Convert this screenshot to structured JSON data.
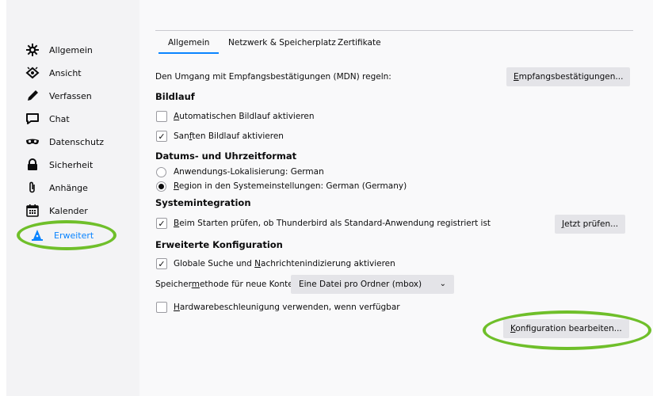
{
  "sidebar": {
    "items": [
      {
        "label": "Allgemein",
        "icon": "gear-icon"
      },
      {
        "label": "Ansicht",
        "icon": "view-icon"
      },
      {
        "label": "Verfassen",
        "icon": "pencil-icon"
      },
      {
        "label": "Chat",
        "icon": "chat-icon"
      },
      {
        "label": "Datenschutz",
        "icon": "mask-icon"
      },
      {
        "label": "Sicherheit",
        "icon": "lock-icon"
      },
      {
        "label": "Anhänge",
        "icon": "paperclip-icon"
      },
      {
        "label": "Kalender",
        "icon": "calendar-icon"
      },
      {
        "label": "Erweitert",
        "icon": "wizard-icon"
      }
    ],
    "active": "Erweitert"
  },
  "tabs": [
    {
      "label": "Allgemein",
      "selected": true
    },
    {
      "label": "Netzwerk & Speicherplatz",
      "selected": false
    },
    {
      "label": "Zertifikate",
      "selected": false
    }
  ],
  "mdn": {
    "text": "Den Umgang mit Empfangsbestätigungen (MDN) regeln:",
    "button_accel": "E",
    "button_rest": "mpfangsbestätigungen..."
  },
  "bildlauf": {
    "heading": "Bildlauf",
    "auto_accel": "A",
    "auto_rest": "utomatischen Bildlauf aktivieren",
    "auto_checked": false,
    "smooth_pre": "San",
    "smooth_accel": "f",
    "smooth_rest": "ten Bildlauf aktivieren",
    "smooth_checked": true
  },
  "datum": {
    "heading": "Datums- und Uhrzeitformat",
    "app_locale": "Anwendungs-Lokalisierung: German",
    "app_selected": false,
    "region_accel": "R",
    "region_rest": "egion in den Systemeinstellungen: German (Germany)",
    "region_selected": true
  },
  "system": {
    "heading": "Systemintegration",
    "check_accel": "B",
    "check_rest": "eim Starten prüfen, ob Thunderbird als Standard-Anwendung registriert ist",
    "checked": true,
    "button_accel": "J",
    "button_rest": "etzt prüfen..."
  },
  "erweitert": {
    "heading": "Erweiterte Konfiguration",
    "search_pre": "Globale Suche und ",
    "search_accel": "N",
    "search_rest": "achrichtenindizierung aktivieren",
    "search_checked": true,
    "storage_pre": "Speicher",
    "storage_accel": "m",
    "storage_rest": "ethode für neue Konten:",
    "storage_value": "Eine Datei pro Ordner (mbox)",
    "hw_accel": "H",
    "hw_rest": "ardwarebeschleunigung verwenden, wenn verfügbar",
    "hw_checked": false,
    "konfig_accel": "K",
    "konfig_rest": "onfiguration bearbeiten..."
  },
  "colors": {
    "accent": "#0a84ff",
    "highlight": "#6fbf2a"
  }
}
